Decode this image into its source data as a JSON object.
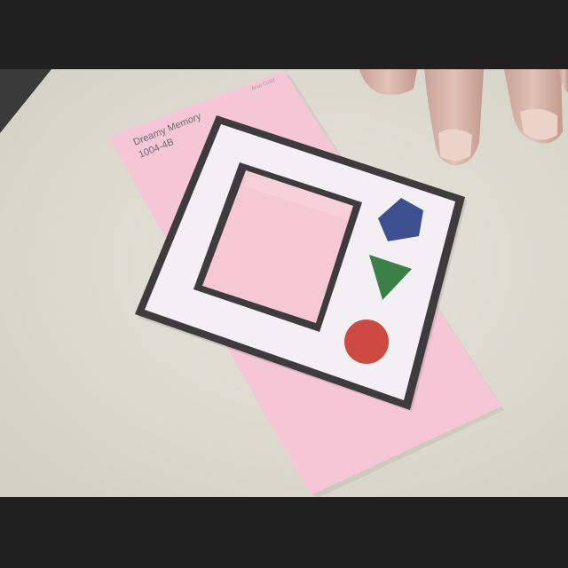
{
  "swatch": {
    "name": "Dreamy Memory",
    "code": "1004-4B",
    "brand": "Arvo Color",
    "color": "#f4c6d6"
  },
  "card": {
    "frame_color": "#3d3b3c",
    "paper_color": "#f2f0f2",
    "window_color": "#f5c8d4"
  },
  "shapes": [
    {
      "shape": "pentagon",
      "color": "#3d4f8f"
    },
    {
      "shape": "triangle",
      "color": "#3a8048"
    },
    {
      "shape": "circle",
      "color": "#cd4a42"
    }
  ],
  "colors": {
    "letterbox": "#202020",
    "table": "#dfdcd1",
    "skin": "#d9b7ab"
  }
}
